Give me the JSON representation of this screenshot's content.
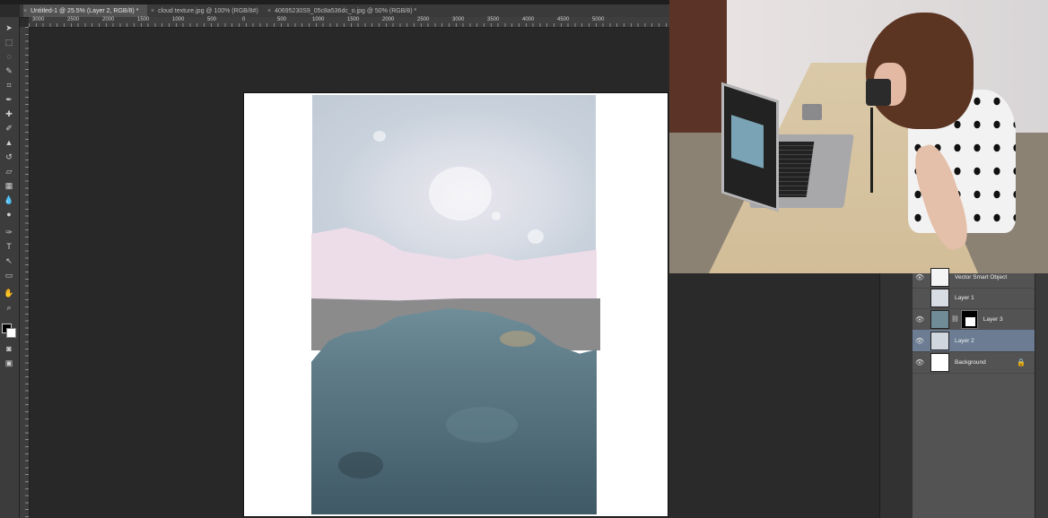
{
  "tabs": [
    {
      "label": "Untitled-1 @ 25.5% (Layer 2, RGB/8) *",
      "active": true
    },
    {
      "label": "cloud texture.jpg @ 100% (RGB/8#)",
      "active": false
    },
    {
      "label": "40695230S9_05c8a536dc_o.jpg @ 50% (RGB/8) *",
      "active": false
    }
  ],
  "ruler_labels": [
    "3000",
    "2500",
    "2000",
    "1500",
    "1000",
    "500",
    "0",
    "500",
    "1000",
    "1500",
    "2000",
    "2500",
    "3000",
    "3500",
    "4000",
    "4500",
    "5000"
  ],
  "tools": [
    "move-icon",
    "marquee-icon",
    "lasso-icon",
    "quick-select-icon",
    "crop-icon",
    "eyedropper-icon",
    "healing-icon",
    "brush-icon",
    "stamp-icon",
    "history-brush-icon",
    "eraser-icon",
    "gradient-icon",
    "blur-icon",
    "dodge-icon",
    "pen-icon",
    "type-icon",
    "path-select-icon",
    "shape-icon",
    "hand-icon",
    "zoom-icon"
  ],
  "layers": [
    {
      "name": "Vector Smart Object",
      "visible": true,
      "selected": false
    },
    {
      "name": "Layer 1",
      "visible": false,
      "selected": false
    },
    {
      "name": "Layer 3",
      "visible": true,
      "selected": false,
      "has_mask": true
    },
    {
      "name": "Layer 2",
      "visible": true,
      "selected": true
    },
    {
      "name": "Background",
      "visible": true,
      "selected": false,
      "locked": true
    }
  ],
  "colors": {
    "selected_layer": "#6b7c93",
    "panel": "#535353",
    "canvas": "#ffffff"
  }
}
